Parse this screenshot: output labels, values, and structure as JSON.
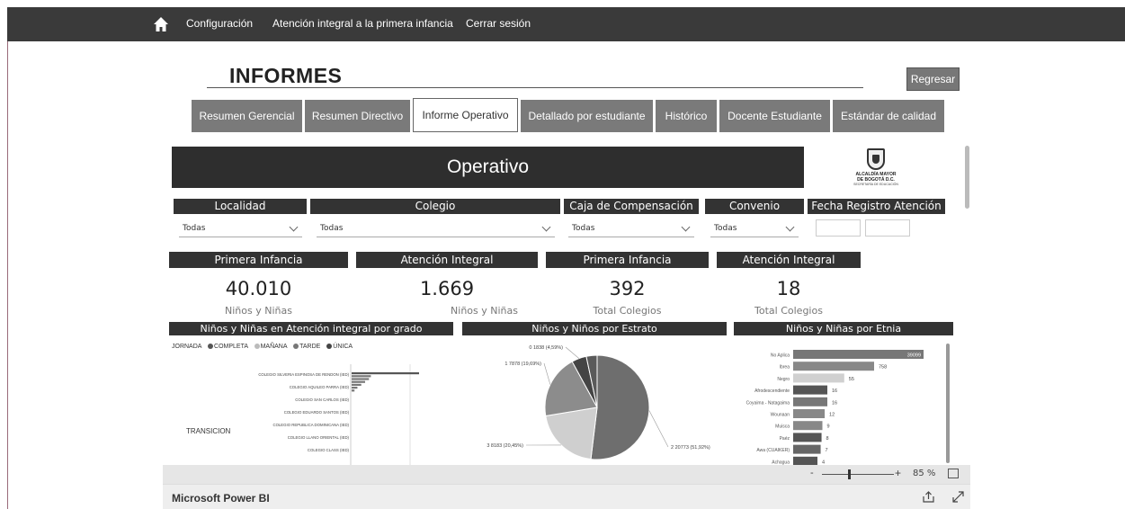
{
  "nav": {
    "items": [
      "Configuración",
      "Atención integral a la primera infancia",
      "Cerrar sesión"
    ]
  },
  "page": {
    "title": "INFORMES",
    "back_label": "Regresar"
  },
  "tabs": [
    {
      "label": "Resumen Gerencial",
      "active": false
    },
    {
      "label": "Resumen Directivo",
      "active": false
    },
    {
      "label": "Informe Operativo",
      "active": true
    },
    {
      "label": "Detallado por estudiante",
      "active": false
    },
    {
      "label": "Histórico",
      "active": false
    },
    {
      "label": "Docente Estudiante",
      "active": false
    },
    {
      "label": "Estándar de calidad",
      "active": false
    }
  ],
  "report": {
    "banner": "Operativo",
    "logo_line1": "ALCALDÍA MAYOR",
    "logo_line2": "DE BOGOTÁ D.C.",
    "logo_line3": "SECRETARÍA DE EDUCACIÓN"
  },
  "filters": [
    {
      "label": "Localidad",
      "value": "Todas"
    },
    {
      "label": "Colegio",
      "value": "Todas"
    },
    {
      "label": "Caja de Compensación",
      "value": "Todas"
    },
    {
      "label": "Convenio",
      "value": "Todas"
    },
    {
      "label": "Fecha Registro Atención",
      "value": ""
    }
  ],
  "kpis": [
    {
      "header": "Primera Infancia",
      "value": "40.010",
      "sub": "Niños y Niñas"
    },
    {
      "header": "Atención Integral",
      "value": "1.669",
      "sub": "Niños y Niñas"
    },
    {
      "header": "Primera Infancia",
      "value": "392",
      "sub": "Total Colegios"
    },
    {
      "header": "Atención Integral",
      "value": "18",
      "sub": "Total Colegios"
    }
  ],
  "charts": {
    "grado_title": "Niños y Niñas en Atención integral por grado",
    "estrato_title": "Niños y Niños por Estrato",
    "etnia_title": "Niños y Niñas por Etnia",
    "legend_title": "JORNADA",
    "legend_items": [
      {
        "label": "COMPLETA",
        "color": "#555555"
      },
      {
        "label": "MAÑANA",
        "color": "#bbbbbb"
      },
      {
        "label": "TARDE",
        "color": "#777777"
      },
      {
        "label": "ÚNICA",
        "color": "#444444"
      }
    ]
  },
  "chart_data": [
    {
      "type": "bar",
      "title": "Niños y Niñas en Atención integral por grado",
      "group_label": "TRANSICION",
      "categories": [
        "COLEGIO SILVERIA ESPINOSA DE RENDON (IED)",
        "COLEGIO AQUILEO PARRA (IED)",
        "COLEGIO SAN CARLOS (IED)",
        "COLEGIO EDUARDO SANTOS (IED)",
        "COLEGIO REPUBLICA DOMINICANA (IED)",
        "COLEGIO LLANO ORIENTAL (IED)",
        "COLEGIO CLASS (IED)"
      ],
      "values": [
        70,
        20,
        18,
        14,
        10,
        6,
        3
      ]
    },
    {
      "type": "pie",
      "title": "Niños y Niños por Estrato",
      "slices": [
        {
          "label": "2 20773 (51,92%)",
          "value": 20773,
          "color": "#6e6e6e"
        },
        {
          "label": "3 8183 (20,45%)",
          "value": 8183,
          "color": "#cfcfcf"
        },
        {
          "label": "1 7878 (19,69%)",
          "value": 7878,
          "color": "#8c8c8c"
        },
        {
          "label": "0 1838 (4,59%)",
          "value": 1838,
          "color": "#444444"
        },
        {
          "label": "",
          "value": 1338,
          "color": "#5a5a5a"
        }
      ]
    },
    {
      "type": "bar",
      "title": "Niños y Niñas por Etnia",
      "categories": [
        "No Aplica",
        "Ibrea",
        "Negro",
        "Afrodescendiente",
        "Coyaima - Natagaima",
        "Wounaan",
        "Muisca",
        "Paéz",
        "Awa (CUAIKER)",
        "Achagua"
      ],
      "values": [
        39099,
        758,
        55,
        16,
        16,
        12,
        9,
        8,
        7,
        4
      ],
      "labels": [
        "39099",
        "758",
        "55",
        "16",
        "16",
        "12",
        "9",
        "8",
        "7",
        "4"
      ]
    }
  ],
  "zoom": {
    "level": "85 %",
    "minus": "-",
    "plus": "+"
  },
  "footer": {
    "app_name": "Microsoft Power BI"
  }
}
